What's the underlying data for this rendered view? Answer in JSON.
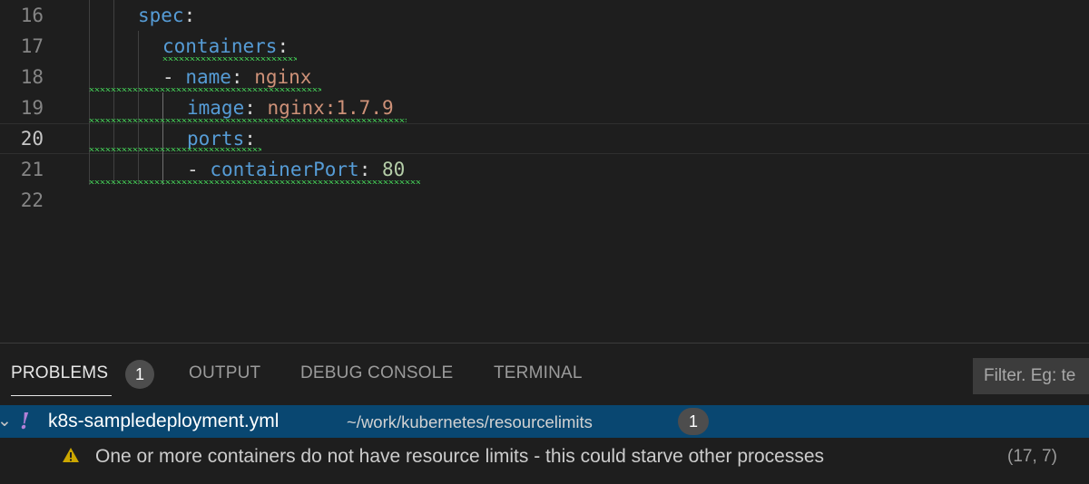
{
  "editor": {
    "lines": [
      {
        "number": "16",
        "code": "spec:"
      },
      {
        "number": "17",
        "code": "containers:"
      },
      {
        "number": "18",
        "code": "- name: nginx"
      },
      {
        "number": "19",
        "code": "image: nginx:1.7.9"
      },
      {
        "number": "20",
        "code": "ports:"
      },
      {
        "number": "21",
        "code": "- containerPort: 80"
      },
      {
        "number": "22",
        "code": ""
      }
    ],
    "tokens": {
      "spec_key": "spec",
      "containers_key": "containers",
      "dash": "-",
      "name_key": "name",
      "name_val": "nginx",
      "image_key": "image",
      "image_val": "nginx:1.7.9",
      "ports_key": "ports",
      "containerport_key": "containerPort",
      "containerport_val": "80",
      "colon": ":"
    },
    "current_line": "20"
  },
  "panel": {
    "tabs": [
      {
        "label": "PROBLEMS",
        "active": true
      },
      {
        "label": "OUTPUT"
      },
      {
        "label": "DEBUG CONSOLE"
      },
      {
        "label": "TERMINAL"
      }
    ],
    "problems_count": "1",
    "filter_placeholder": "Filter. Eg: te",
    "file": {
      "name": "k8s-sampledeployment.yml",
      "path": "~/work/kubernetes/resourcelimits",
      "count": "1",
      "icon": "exclamation-icon"
    },
    "problem": {
      "icon": "warning-icon",
      "message": "One or more containers do not have resource limits - this could starve other processes",
      "location": "(17, 7)"
    }
  },
  "colors": {
    "background": "#1e1e1e",
    "key": "#569cd6",
    "string": "#ce9178",
    "number": "#b5cea8",
    "squiggle": "#3fb950",
    "selection": "#094771",
    "warning": "#cca700"
  }
}
